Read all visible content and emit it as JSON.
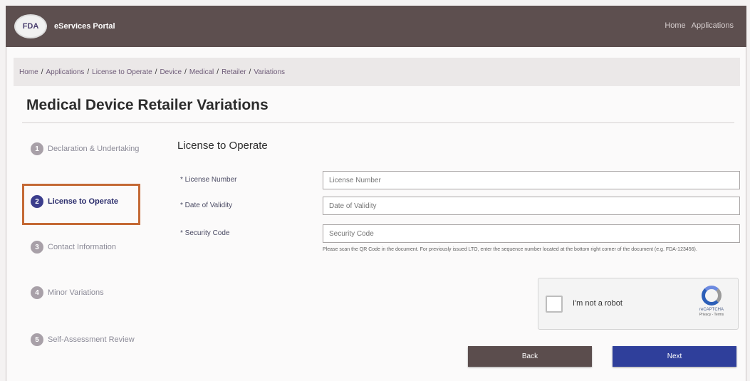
{
  "header": {
    "logo_text": "FDA",
    "portal_title": "eServices Portal",
    "nav": [
      "Home",
      "Applications"
    ]
  },
  "breadcrumb": [
    "Home",
    "Applications",
    "License to Operate",
    "Device",
    "Medical",
    "Retailer",
    "Variations"
  ],
  "page_title": "Medical Device Retailer Variations",
  "steps": [
    {
      "number": "1",
      "label": "Declaration & Undertaking"
    },
    {
      "number": "2",
      "label": "License to Operate"
    },
    {
      "number": "3",
      "label": "Contact Information"
    },
    {
      "number": "4",
      "label": "Minor Variations"
    },
    {
      "number": "5",
      "label": "Self-Assessment Review"
    }
  ],
  "form": {
    "section_title": "License to Operate",
    "fields": [
      {
        "label": "* License Number",
        "placeholder": "License Number"
      },
      {
        "label": "* Date of Validity",
        "placeholder": "Date of Validity"
      },
      {
        "label": "* Security Code",
        "placeholder": "Security Code"
      }
    ],
    "hint": "Please scan the QR Code in the document. For previously issued LTO, enter the sequence number located at the bottom right corner of the document (e.g. FDA-123456)."
  },
  "captcha": {
    "label": "I'm not a robot",
    "brand": "reCAPTCHA",
    "links": "Privacy - Terms"
  },
  "buttons": {
    "back": "Back",
    "next": "Next"
  }
}
